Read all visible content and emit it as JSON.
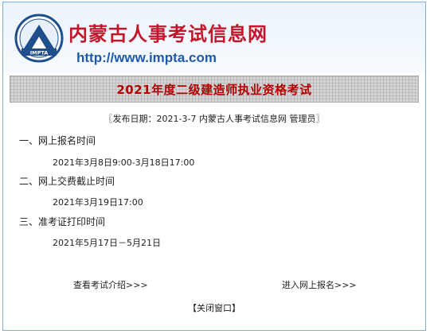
{
  "header": {
    "site_name": "内蒙古人事考试信息网",
    "url": "http://www.impta.com",
    "logo_text": "IMPTA"
  },
  "title": "2021年度二级建造师执业资格考试",
  "meta": {
    "text": "〖发布日期：2021-3-7  内蒙古人事考试信息网 管理员〗"
  },
  "sections": [
    {
      "heading": "一、网上报名时间",
      "detail": "2021年3月8日9:00-3月18日17:00"
    },
    {
      "heading": "二、网上交费截止时间",
      "detail": "2021年3月19日17:00"
    },
    {
      "heading": "三、准考证打印时间",
      "detail": "2021年5月17日－5月21日"
    }
  ],
  "links": {
    "intro": "查看考试介绍>>>",
    "register": "进入网上报名>>>"
  },
  "close_label": "【关闭窗口】",
  "colors": {
    "site_name": "#c4162a",
    "url": "#1e5aa8",
    "title": "#b20000",
    "border": "#7fb1dc"
  }
}
